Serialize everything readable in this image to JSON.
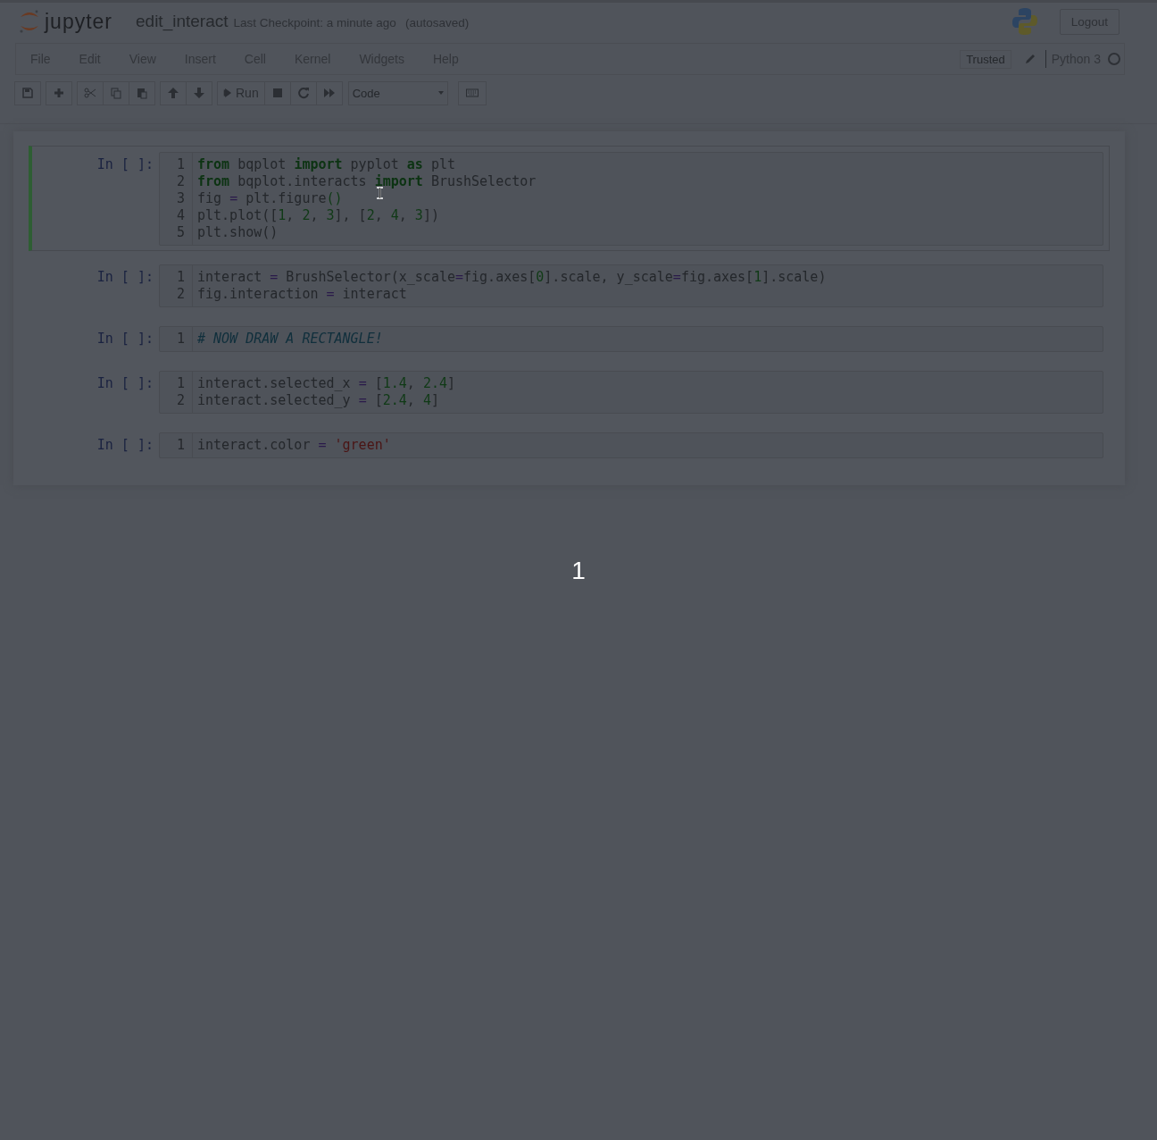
{
  "header": {
    "logo_text": "jupyter",
    "notebook_name": "edit_interact",
    "checkpoint": "Last Checkpoint: a minute ago",
    "autosave": "(autosaved)",
    "logout": "Logout"
  },
  "menu": {
    "items": [
      "File",
      "Edit",
      "View",
      "Insert",
      "Cell",
      "Kernel",
      "Widgets",
      "Help"
    ],
    "trusted": "Trusted",
    "kernel_name": "Python 3",
    "kernel_busy": false
  },
  "toolbar": {
    "run_label": "Run",
    "cell_type": "Code"
  },
  "cells": [
    {
      "prompt": "In [ ]:",
      "selected": true,
      "cursor": true,
      "lines": [
        {
          "number": "1",
          "tokens": [
            {
              "kind": "keyword",
              "text": "from"
            },
            {
              "kind": "plain",
              "text": " bqplot "
            },
            {
              "kind": "keyword",
              "text": "import"
            },
            {
              "kind": "plain",
              "text": " pyplot "
            },
            {
              "kind": "keyword",
              "text": "as"
            },
            {
              "kind": "plain",
              "text": " plt"
            }
          ]
        },
        {
          "number": "2",
          "tokens": [
            {
              "kind": "keyword",
              "text": "from"
            },
            {
              "kind": "plain",
              "text": " bqplot.interacts "
            },
            {
              "kind": "keyword",
              "text": "import"
            },
            {
              "kind": "plain",
              "text": " BrushSelector"
            }
          ]
        },
        {
          "number": "3",
          "tokens": [
            {
              "kind": "plain",
              "text": "fig "
            },
            {
              "kind": "operator",
              "text": "="
            },
            {
              "kind": "plain",
              "text": " plt.figure"
            },
            {
              "kind": "bracket",
              "text": "()"
            }
          ]
        },
        {
          "number": "4",
          "tokens": [
            {
              "kind": "plain",
              "text": "plt.plot(["
            },
            {
              "kind": "number",
              "text": "1"
            },
            {
              "kind": "plain",
              "text": ", "
            },
            {
              "kind": "number",
              "text": "2"
            },
            {
              "kind": "plain",
              "text": ", "
            },
            {
              "kind": "number",
              "text": "3"
            },
            {
              "kind": "plain",
              "text": "], ["
            },
            {
              "kind": "number",
              "text": "2"
            },
            {
              "kind": "plain",
              "text": ", "
            },
            {
              "kind": "number",
              "text": "4"
            },
            {
              "kind": "plain",
              "text": ", "
            },
            {
              "kind": "number",
              "text": "3"
            },
            {
              "kind": "plain",
              "text": "])"
            }
          ]
        },
        {
          "number": "5",
          "tokens": [
            {
              "kind": "plain",
              "text": "plt.show()"
            }
          ]
        }
      ]
    },
    {
      "prompt": "In [ ]:",
      "selected": false,
      "cursor": false,
      "lines": [
        {
          "number": "1",
          "tokens": [
            {
              "kind": "plain",
              "text": "interact "
            },
            {
              "kind": "operator",
              "text": "="
            },
            {
              "kind": "plain",
              "text": " BrushSelector(x_scale"
            },
            {
              "kind": "operator",
              "text": "="
            },
            {
              "kind": "plain",
              "text": "fig.axes["
            },
            {
              "kind": "number",
              "text": "0"
            },
            {
              "kind": "plain",
              "text": "].scale, y_scale"
            },
            {
              "kind": "operator",
              "text": "="
            },
            {
              "kind": "plain",
              "text": "fig.axes["
            },
            {
              "kind": "number",
              "text": "1"
            },
            {
              "kind": "plain",
              "text": "].scale)"
            }
          ]
        },
        {
          "number": "2",
          "tokens": [
            {
              "kind": "plain",
              "text": "fig.interaction "
            },
            {
              "kind": "operator",
              "text": "="
            },
            {
              "kind": "plain",
              "text": " interact"
            }
          ]
        }
      ]
    },
    {
      "prompt": "In [ ]:",
      "selected": false,
      "cursor": false,
      "lines": [
        {
          "number": "1",
          "tokens": [
            {
              "kind": "comment",
              "text": "# NOW DRAW A RECTANGLE!"
            }
          ]
        }
      ]
    },
    {
      "prompt": "In [ ]:",
      "selected": false,
      "cursor": false,
      "lines": [
        {
          "number": "1",
          "tokens": [
            {
              "kind": "plain",
              "text": "interact.selected_x "
            },
            {
              "kind": "operator",
              "text": "="
            },
            {
              "kind": "plain",
              "text": " ["
            },
            {
              "kind": "number",
              "text": "1.4"
            },
            {
              "kind": "plain",
              "text": ", "
            },
            {
              "kind": "number",
              "text": "2.4"
            },
            {
              "kind": "plain",
              "text": "]"
            }
          ]
        },
        {
          "number": "2",
          "tokens": [
            {
              "kind": "plain",
              "text": "interact.selected_y "
            },
            {
              "kind": "operator",
              "text": "="
            },
            {
              "kind": "plain",
              "text": " ["
            },
            {
              "kind": "number",
              "text": "2.4"
            },
            {
              "kind": "plain",
              "text": ", "
            },
            {
              "kind": "number",
              "text": "4"
            },
            {
              "kind": "plain",
              "text": "]"
            }
          ]
        }
      ]
    },
    {
      "prompt": "In [ ]:",
      "selected": false,
      "cursor": false,
      "lines": [
        {
          "number": "1",
          "tokens": [
            {
              "kind": "plain",
              "text": "interact.color "
            },
            {
              "kind": "operator",
              "text": "="
            },
            {
              "kind": "string",
              "text": " 'green'"
            }
          ]
        }
      ]
    }
  ],
  "frame_counter": "1"
}
